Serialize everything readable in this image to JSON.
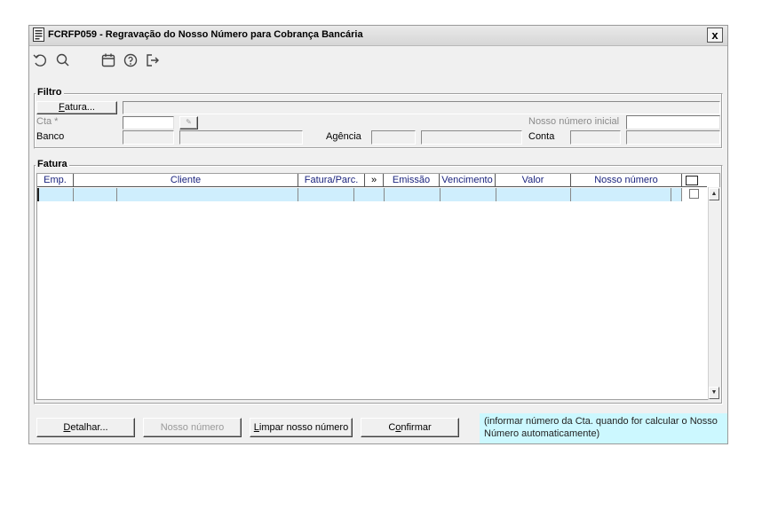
{
  "window": {
    "title": "FCRFP059 - Regravação do Nosso Número para Cobrança Bancária",
    "close_label": "x"
  },
  "toolbar": {
    "icons": [
      "undo-icon",
      "search-icon",
      "calendar-icon",
      "help-icon",
      "exit-icon"
    ]
  },
  "filtro": {
    "legend": "Filtro",
    "fatura_button": "Fatura...",
    "cta_label": "Cta *",
    "nosso_numero_inicial_label": "Nosso número inicial",
    "banco_label": "Banco",
    "agencia_label": "Agência",
    "conta_label": "Conta"
  },
  "fatura": {
    "legend": "Fatura",
    "columns": [
      "Emp.",
      "Cliente",
      "Fatura/Parc.",
      "»",
      "Emissão",
      "Vencimento",
      "Valor",
      "Nosso número"
    ]
  },
  "footer": {
    "detalhar_button": "Detalhar...",
    "nosso_numero_button": "Nosso número",
    "limpar_button": "Limpar nosso número",
    "confirmar_button": "Confirmar",
    "info_text": "(informar número da Cta. quando for calcular o Nosso Número automaticamente)"
  }
}
